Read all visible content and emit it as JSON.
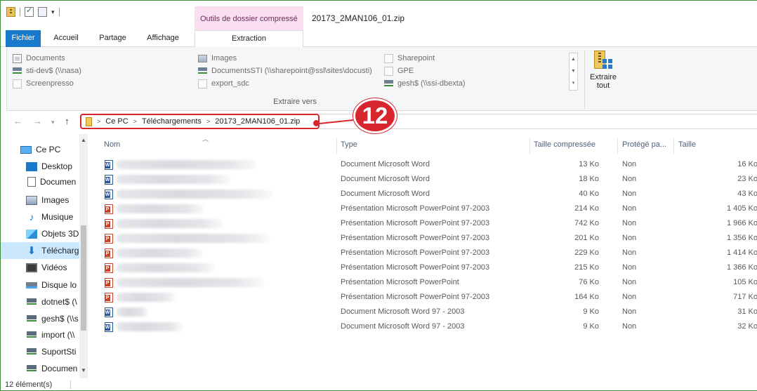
{
  "window": {
    "title": "20173_2MAN106_01.zip",
    "context_tab_header": "Outils de dossier compressé"
  },
  "ribbon_tabs": [
    "Fichier",
    "Accueil",
    "Partage",
    "Affichage",
    "Extraction"
  ],
  "ribbon": {
    "locations_col1": [
      "Documents",
      "sti-dev$ (\\\\nasa)",
      "Screenpresso"
    ],
    "locations_col2": [
      "Images",
      "DocumentsSTI (\\\\sharepoint@ssl\\sites\\docusti)",
      "export_sdc"
    ],
    "locations_col3": [
      "Sharepoint",
      "GPE",
      "gesh$ (\\\\ssi-dbexta)"
    ],
    "group_label": "Extraire vers",
    "extract_all_line1": "Extraire",
    "extract_all_line2": "tout"
  },
  "address": {
    "crumbs": [
      "Ce PC",
      "Téléchargements",
      "20173_2MAN106_01.zip"
    ]
  },
  "annotation": {
    "badge": "12",
    "color": "#d8262e"
  },
  "nav_pane": {
    "items": [
      {
        "label": "Ce PC",
        "icon": "computer-icon"
      },
      {
        "label": "Desktop",
        "icon": "desktop-icon"
      },
      {
        "label": "Documen",
        "icon": "documents-icon"
      },
      {
        "label": "Images",
        "icon": "pictures-icon"
      },
      {
        "label": "Musique",
        "icon": "music-icon"
      },
      {
        "label": "Objets 3D",
        "icon": "objects-3d-icon"
      },
      {
        "label": "Télécharg",
        "icon": "downloads-icon"
      },
      {
        "label": "Vidéos",
        "icon": "videos-icon"
      },
      {
        "label": "Disque lo",
        "icon": "local-disk-icon"
      },
      {
        "label": "dotnet$ (\\",
        "icon": "network-drive-icon"
      },
      {
        "label": "gesh$ (\\\\s",
        "icon": "network-drive-icon"
      },
      {
        "label": "import (\\\\",
        "icon": "network-drive-icon"
      },
      {
        "label": "SuportSti",
        "icon": "network-drive-icon"
      },
      {
        "label": "Documen",
        "icon": "network-drive-icon"
      }
    ]
  },
  "columns": {
    "name": "Nom",
    "type": "Type",
    "compressed": "Taille compressée",
    "protected": "Protégé pa...",
    "size": "Taille"
  },
  "files": [
    {
      "type": "Document Microsoft Word",
      "compressed": "13 Ko",
      "protected": "Non",
      "size": "16 Ko",
      "icon": "word"
    },
    {
      "type": "Document Microsoft Word",
      "compressed": "18 Ko",
      "protected": "Non",
      "size": "23 Ko",
      "icon": "word"
    },
    {
      "type": "Document Microsoft Word",
      "compressed": "40 Ko",
      "protected": "Non",
      "size": "43 Ko",
      "icon": "word"
    },
    {
      "type": "Présentation Microsoft PowerPoint 97-2003",
      "compressed": "214 Ko",
      "protected": "Non",
      "size": "1 405 Ko",
      "icon": "ppt"
    },
    {
      "type": "Présentation Microsoft PowerPoint 97-2003",
      "compressed": "742 Ko",
      "protected": "Non",
      "size": "1 966 Ko",
      "icon": "ppt"
    },
    {
      "type": "Présentation Microsoft PowerPoint 97-2003",
      "compressed": "201 Ko",
      "protected": "Non",
      "size": "1 356 Ko",
      "icon": "ppt"
    },
    {
      "type": "Présentation Microsoft PowerPoint 97-2003",
      "compressed": "229 Ko",
      "protected": "Non",
      "size": "1 414 Ko",
      "icon": "ppt"
    },
    {
      "type": "Présentation Microsoft PowerPoint 97-2003",
      "compressed": "215 Ko",
      "protected": "Non",
      "size": "1 366 Ko",
      "icon": "ppt"
    },
    {
      "type": "Présentation Microsoft PowerPoint",
      "compressed": "76 Ko",
      "protected": "Non",
      "size": "105 Ko",
      "icon": "ppt"
    },
    {
      "type": "Présentation Microsoft PowerPoint 97-2003",
      "compressed": "164 Ko",
      "protected": "Non",
      "size": "717 Ko",
      "icon": "ppt"
    },
    {
      "type": "Document Microsoft Word 97 - 2003",
      "compressed": "9 Ko",
      "protected": "Non",
      "size": "31 Ko",
      "icon": "word"
    },
    {
      "type": "Document Microsoft Word 97 - 2003",
      "compressed": "9 Ko",
      "protected": "Non",
      "size": "32 Ko",
      "icon": "word"
    }
  ],
  "status": {
    "count": "12 élément(s)"
  }
}
